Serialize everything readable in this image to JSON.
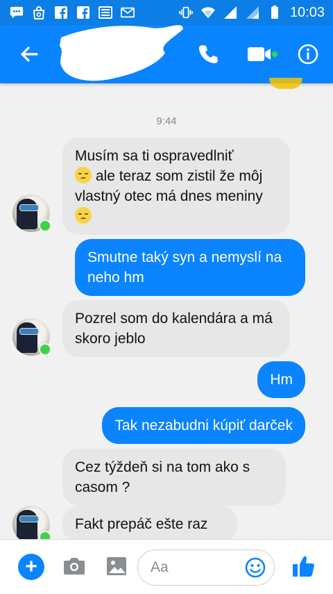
{
  "status_bar": {
    "time": "10:03",
    "left_icons": [
      "messenger-notification-icon",
      "shopping-bag-icon",
      "facebook-icon",
      "facebook-icon",
      "news-icon",
      "gmail-icon"
    ],
    "right_icons": [
      "vibrate-icon",
      "wifi-icon",
      "signal-icon",
      "signal-icon",
      "battery-icon"
    ]
  },
  "header": {
    "back_icon": "arrow-left-icon",
    "call_icon": "phone-icon",
    "video_icon": "video-camera-icon",
    "info_icon": "info-icon",
    "accent_color": "#0b84ff"
  },
  "conversation": {
    "timestamp": "9:44",
    "messages": [
      {
        "from": "contact",
        "parts": [
          "Musím sa ti ospravedlniť",
          "ale teraz som zistil že môj vlastný otec má dnes meniny"
        ]
      },
      {
        "from": "me",
        "text": "Smutne taký syn a nemyslí na neho hm"
      },
      {
        "from": "contact",
        "text": "Pozrel som do kalendára a má skoro jeblo"
      },
      {
        "from": "me",
        "text": "Hm"
      },
      {
        "from": "me",
        "text": "Tak nezabudni kúpiť darček"
      },
      {
        "from": "contact",
        "text": "Cez týždeň si na tom ako s casom ?"
      },
      {
        "from": "contact",
        "text": "Fakt prepáč ešte raz"
      }
    ],
    "emoji": "disappointed-face-icon"
  },
  "composer": {
    "placeholder": "Aa",
    "icons": [
      "plus-icon",
      "camera-icon",
      "image-icon",
      "emoji-icon",
      "thumbs-up-icon"
    ]
  }
}
